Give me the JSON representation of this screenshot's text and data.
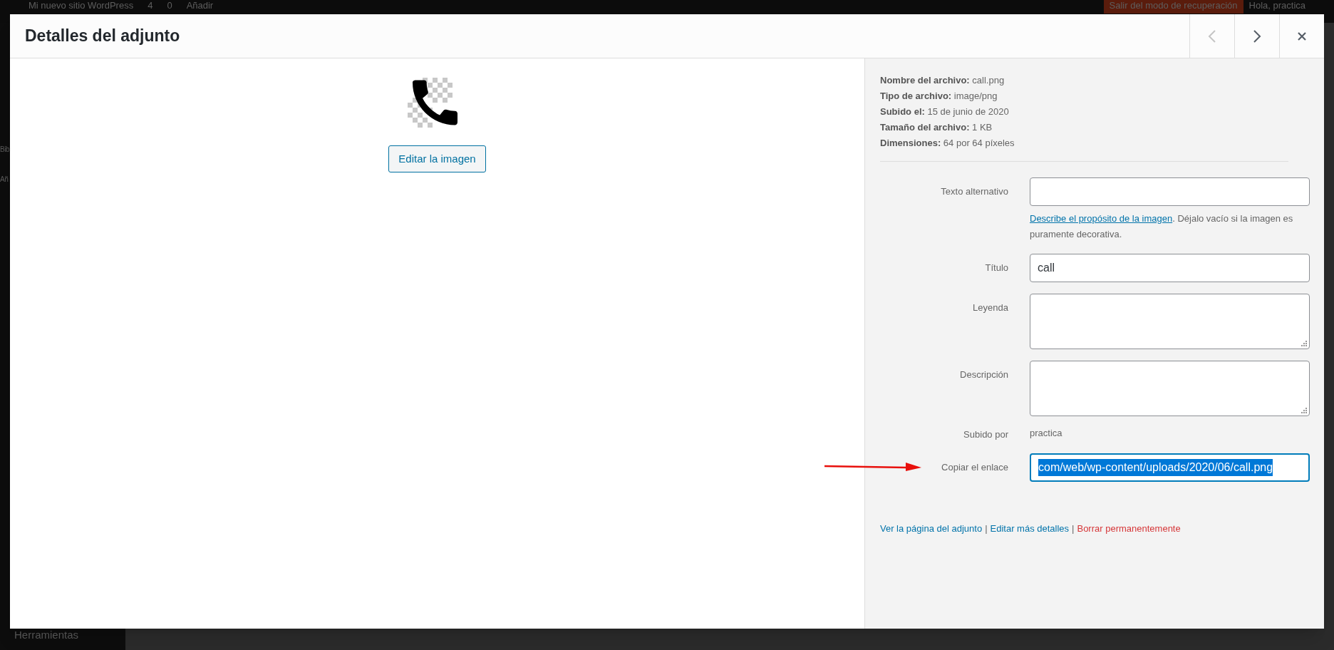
{
  "admin_bar": {
    "site_name": "Mi nuevo sitio WordPress",
    "updates": "4",
    "comments": "0",
    "new": "Añadir",
    "recovery_button": "Salir del modo de recuperación",
    "greeting": "Hola, practica"
  },
  "admin_menu": {
    "items": [
      {
        "label": "Bib"
      },
      {
        "label": "Añ"
      },
      {
        "label": "Herramientas"
      }
    ]
  },
  "dialog": {
    "title": "Detalles del adjunto",
    "preview": {
      "edit_button": "Editar la imagen"
    },
    "details": [
      {
        "label": "Nombre del archivo:",
        "value": "call.png"
      },
      {
        "label": "Tipo de archivo:",
        "value": "image/png"
      },
      {
        "label": "Subido el:",
        "value": "15 de junio de 2020"
      },
      {
        "label": "Tamaño del archivo:",
        "value": "1 KB"
      },
      {
        "label": "Dimensiones:",
        "value": "64 por 64 píxeles"
      }
    ],
    "fields": [
      {
        "kind": "input",
        "label": "Texto alternativo",
        "help_link": "Describe el propósito de la imagen",
        "help_text": ". Déjalo vacío si la imagen es puramente decorativa.",
        "text_selected": false,
        "pointer_arrow": false
      },
      {
        "kind": "input",
        "label": "Título",
        "value": "call",
        "text_selected": false,
        "pointer_arrow": false
      },
      {
        "kind": "textarea",
        "label": "Leyenda",
        "text_selected": false,
        "pointer_arrow": false
      },
      {
        "kind": "textarea",
        "label": "Descripción",
        "text_selected": false,
        "pointer_arrow": false
      },
      {
        "kind": "text",
        "label": "Subido por",
        "value": "practica",
        "text_selected": false,
        "pointer_arrow": false
      },
      {
        "kind": "input",
        "label": "Copiar el enlace",
        "value": "com/web/wp-content/uploads/2020/06/call.png",
        "text_selected": true,
        "pointer_arrow": true
      }
    ],
    "links": [
      {
        "label": "Ver la página del adjunto",
        "kind": "normal"
      },
      {
        "label": "Editar más detalles",
        "kind": "normal"
      },
      {
        "label": "Borrar permanentemente",
        "kind": "danger"
      }
    ],
    "separators": [
      "|",
      "|"
    ]
  }
}
